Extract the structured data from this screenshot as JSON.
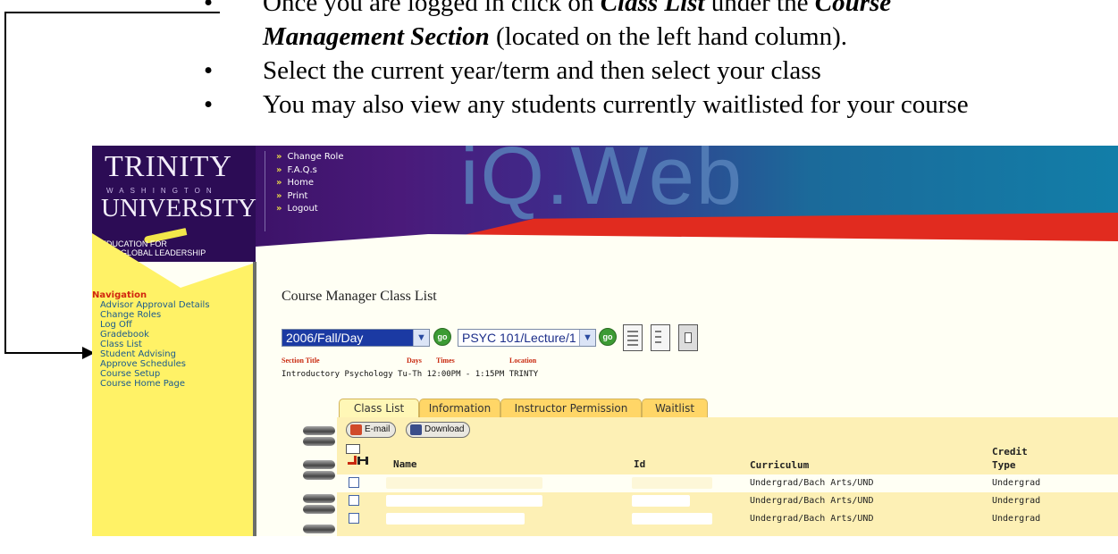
{
  "document": {
    "bullets": [
      {
        "parts": [
          {
            "text": "Once you are logged in click on ",
            "style": "normal"
          },
          {
            "text": "Class List",
            "style": "bold-italic"
          },
          {
            "text": " under the ",
            "style": "normal"
          },
          {
            "text": "Course",
            "style": "bold-italic"
          }
        ],
        "cont": [
          {
            "text": "Management Section",
            "style": "bold-italic"
          },
          {
            "text": " (located on the left hand column).",
            "style": "normal"
          }
        ]
      },
      {
        "parts": [
          {
            "text": "Select the current year/term and then select your class",
            "style": "normal"
          }
        ]
      },
      {
        "parts": [
          {
            "text": "You may also view any students currently waitlisted for your course",
            "style": "normal"
          }
        ]
      }
    ],
    "bullet_glyph": "•"
  },
  "header": {
    "logo_line1": "TRINITY",
    "logo_line2": "WASHINGTON",
    "logo_line3": "UNIVERSITY",
    "logo_tagline1": "EDUCATION FOR",
    "logo_tagline2": "GLOBAL LEADERSHIP",
    "brand": "iQ.Web",
    "top_nav": [
      "Change Role",
      "F.A.Q.s",
      "Home",
      "Print",
      "Logout"
    ],
    "chevron": "»"
  },
  "sidebar": {
    "title": "Navigation",
    "items": [
      "Advisor Approval Details",
      "Change Roles",
      "Log Off",
      "Gradebook",
      "Class List",
      "Student Advising",
      "Approve Schedules",
      "Course Setup",
      "Course Home Page"
    ]
  },
  "main": {
    "page_title": "Course Manager Class List",
    "term_select": "2006/Fall/Day",
    "course_select": "PSYC 101/Lecture/1",
    "go_label": "go",
    "section_headers": {
      "title": "Section Title",
      "days": "Days",
      "times": "Times",
      "location": "Location"
    },
    "section_values": {
      "title": "Introductory Psychology",
      "days": "Tu-Th",
      "times": "12:00PM - 1:15PM",
      "location": "TRINTY"
    },
    "tabs": [
      "Class List",
      "Information",
      "Instructor Permission",
      "Waitlist"
    ],
    "buttons": {
      "email": "E-mail",
      "download": "Download"
    },
    "columns": {
      "name": "Name",
      "id": "Id",
      "curriculum": "Curriculum",
      "credit_line1": "Credit",
      "credit_line2": "Type"
    },
    "rows": [
      {
        "curriculum": "Undergrad/Bach Arts/UND",
        "credit": "Undergrad"
      },
      {
        "curriculum": "Undergrad/Bach Arts/UND",
        "credit": "Undergrad"
      },
      {
        "curriculum": "Undergrad/Bach Arts/UND",
        "credit": "Undergrad"
      }
    ]
  },
  "colors": {
    "sidebar": "#fff266",
    "nav_title": "#d1250e",
    "nav_item": "#1a5a8e",
    "tab": "#ffd667",
    "panel": "#fdf0b5"
  }
}
